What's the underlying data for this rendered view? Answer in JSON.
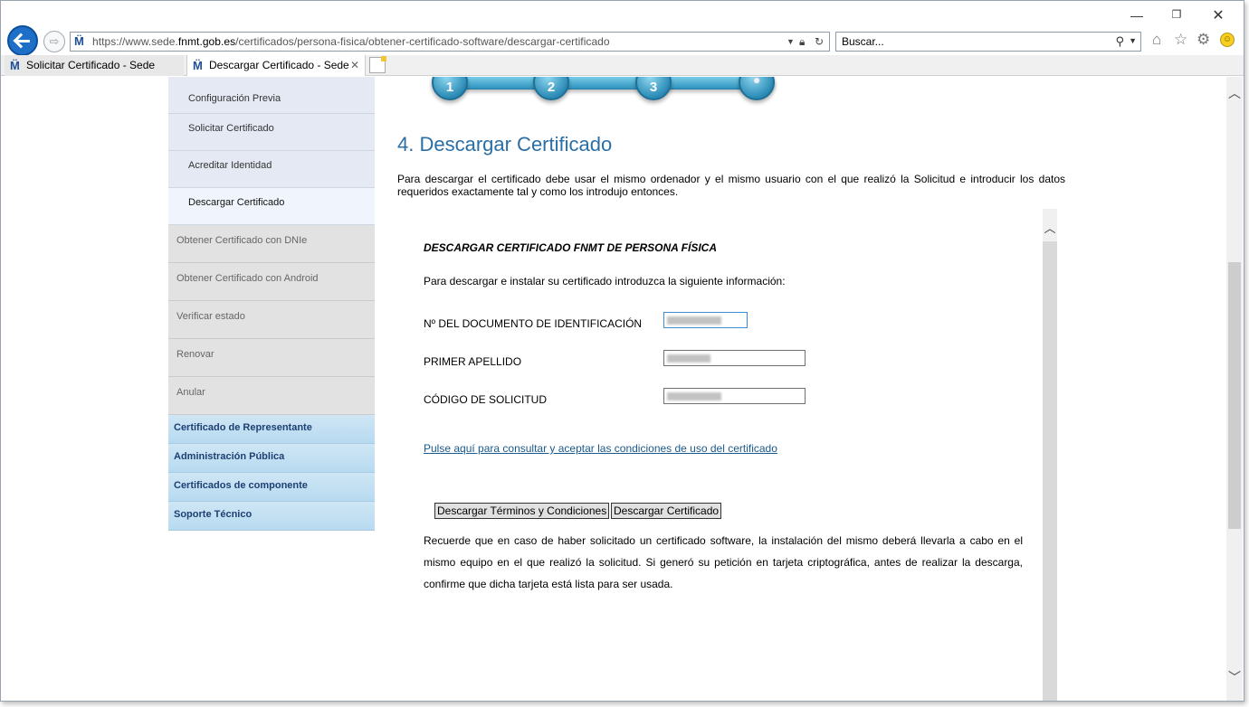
{
  "browser": {
    "url_prefix": "https://www.sede.",
    "url_domain": "fnmt.gob.es",
    "url_path": "/certificados/persona-fisica/obtener-certificado-software/descargar-certificado",
    "search_placeholder": "Buscar...",
    "tabs": [
      {
        "label": "Solicitar Certificado - Sede"
      },
      {
        "label": "Descargar Certificado - Sede"
      }
    ]
  },
  "sidebar": {
    "sub_items": [
      {
        "label": "Configuración Previa"
      },
      {
        "label": "Solicitar Certificado"
      },
      {
        "label": "Acreditar Identidad"
      },
      {
        "label": "Descargar Certificado"
      }
    ],
    "grey_items": [
      {
        "label": "Obtener Certificado con DNIe"
      },
      {
        "label": "Obtener Certificado con Android"
      },
      {
        "label": "Verificar estado"
      },
      {
        "label": "Renovar"
      },
      {
        "label": "Anular"
      }
    ],
    "blue_items": [
      {
        "label": "Certificado de Representante"
      },
      {
        "label": "Administración Pública"
      },
      {
        "label": "Certificados de componente"
      },
      {
        "label": "Soporte Técnico"
      }
    ]
  },
  "steps": [
    "1",
    "2",
    "3"
  ],
  "main": {
    "title": "4. Descargar Certificado",
    "intro": "Para descargar el certificado debe usar el mismo ordenador y el mismo usuario con el que realizó la Solicitud e introducir los datos requeridos exactamente tal y como los introdujo entonces.",
    "form_title": "DESCARGAR CERTIFICADO FNMT DE PERSONA FÍSICA",
    "form_intro": "Para descargar e instalar su certificado introduzca la siguiente información:",
    "fields": [
      {
        "label": "Nº DEL DOCUMENTO DE IDENTIFICACIÓN"
      },
      {
        "label": "PRIMER APELLIDO"
      },
      {
        "label": "CÓDIGO DE SOLICITUD"
      }
    ],
    "conditions_link": "Pulse aquí para consultar y aceptar las condiciones de uso del certificado",
    "btn_terms": "Descargar Términos y Condiciones",
    "btn_download": "Descargar Certificado",
    "notice": "Recuerde que en caso de haber solicitado un certificado software, la instalación del mismo deberá llevarla a cabo en el mismo equipo en el que realizó la solicitud. Si generó su petición en tarjeta criptográfica, antes de realizar la descarga, confirme que dicha tarjeta está lista para ser usada."
  }
}
